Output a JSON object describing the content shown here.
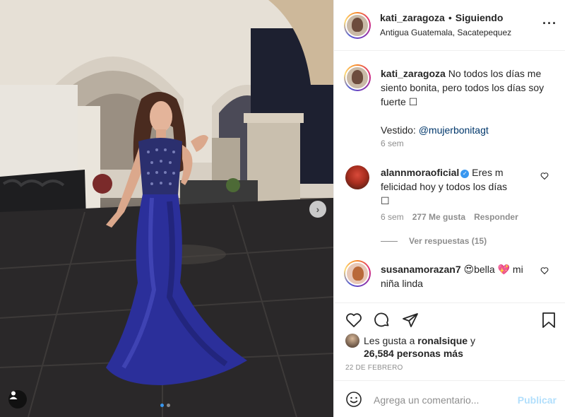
{
  "post": {
    "username": "kati_zaragoza",
    "follow_status": "Siguiendo",
    "location": "Antigua Guatemala, Sacatepequez",
    "more_icon": "more-horizontal-icon"
  },
  "caption": {
    "username": "kati_zaragoza",
    "lines": [
      "No todos los días me",
      "siento bonita, pero todos los días soy",
      "fuerte ☐"
    ],
    "dress_prefix": "Vestido:",
    "dress_mention": "@mujerbonitagt",
    "time": "6 sem"
  },
  "comments": [
    {
      "username": "alannmoraoficial",
      "verified": true,
      "line1": "Eres m",
      "line2": "felicidad hoy y todos los días",
      "line3": "☐",
      "time": "6 sem",
      "likes": "277 Me gusta",
      "reply": "Responder",
      "view_replies": "Ver respuestas (15)"
    },
    {
      "username": "susanamorazan7",
      "emoji1": "😍",
      "word1": "bella",
      "emoji2": "💖",
      "word2": "mi",
      "line2": "niña linda"
    }
  ],
  "likes": {
    "prefix": "Les gusta a",
    "user": "ronalsique",
    "connector": "y",
    "others": "26,584 personas más"
  },
  "date": "22 DE FEBRERO",
  "add_comment": {
    "placeholder": "Agrega un comentario...",
    "publish": "Publicar"
  },
  "colors": {
    "link": "#00376b",
    "verified": "#3897f0",
    "publish_disabled": "#b2dffc",
    "dress": "#27309a"
  }
}
